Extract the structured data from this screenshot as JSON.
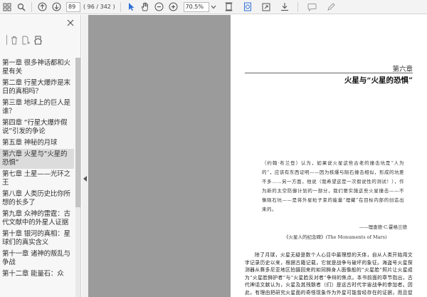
{
  "toolbar": {
    "page_number": "89",
    "page_count": "( 96 / 342 )",
    "zoom": "70.5%"
  },
  "colors": {
    "accent_blue": "#2f6fd6",
    "page_bg": "#9b9b9b",
    "active_item_bg": "#dcdcdc"
  },
  "sidebar": {
    "items": [
      {
        "label": "第一章  很多神话都和火星有关"
      },
      {
        "label": "第二章  行星大爆炸是末日的真相吗？"
      },
      {
        "label": "第三章  地球上的巨人是谁？"
      },
      {
        "label": "第四章  “行星大爆炸假说”引发的争论"
      },
      {
        "label": "第五章  神秘的月球"
      },
      {
        "label": "第六章  火星与“火星的恐惧”"
      },
      {
        "label": "第七章  土星——光环之王"
      },
      {
        "label": "第八章  人类历史比你所想的长多了"
      },
      {
        "label": "第九章  众神的雷霆：古代文献中的外星人证据"
      },
      {
        "label": "第十章  银河的真相：星球们的真实含义"
      },
      {
        "label": "第十一章  诸神的叛乱与争战"
      },
      {
        "label": "第十二章  能量石：众"
      }
    ]
  },
  "page": {
    "chapter_number": "第六章",
    "chapter_title": "火星与“火星的恐惧”",
    "quote": "（约翰·布兰登）认为，如果说火星这些古老的撞击坑是“人为的”，应该有东西证明——因为核爆与陨石撞击相似，形成的坑差不多……另一方面，他说（我希望这是一次假说性的测试！），作为新的太空防御计划的一部分，我们要实施这些火星撞击——不像陨石坑——是将外星粒子束的能量“埋藏”在目标内部的创造出来的。",
    "quote_attribution": "——理查德·C.霍格兰德",
    "quote_source": "《火星人的纪念碑》(The Monuments of Mars)",
    "body": "除了月球，火星无疑是数个人心目中最理想的天体，自从人类开始用文字记录历史以来，根据古籍记载，它就是战争与破坏的象征。海盗号火星探测器从赛多尼亚地区拍摄回来的如同狮身人面像般的“火星脸”照片让火星成为“火星脸狮护者”与“火星脸反对者”争辩的焦点。本书前面的章节指出，古代神话文献认为，火星及其残骸者（们）是远古时代宇宙战争的参加者。因此，有理由把研究火星面的奇怪现象作为外星可能曾经存在的证据，而且促使人们去进一步寻找火星曾遭受过破坏的证据。不过，由大火星探索所引起的大争论中，所以本章对"
  }
}
